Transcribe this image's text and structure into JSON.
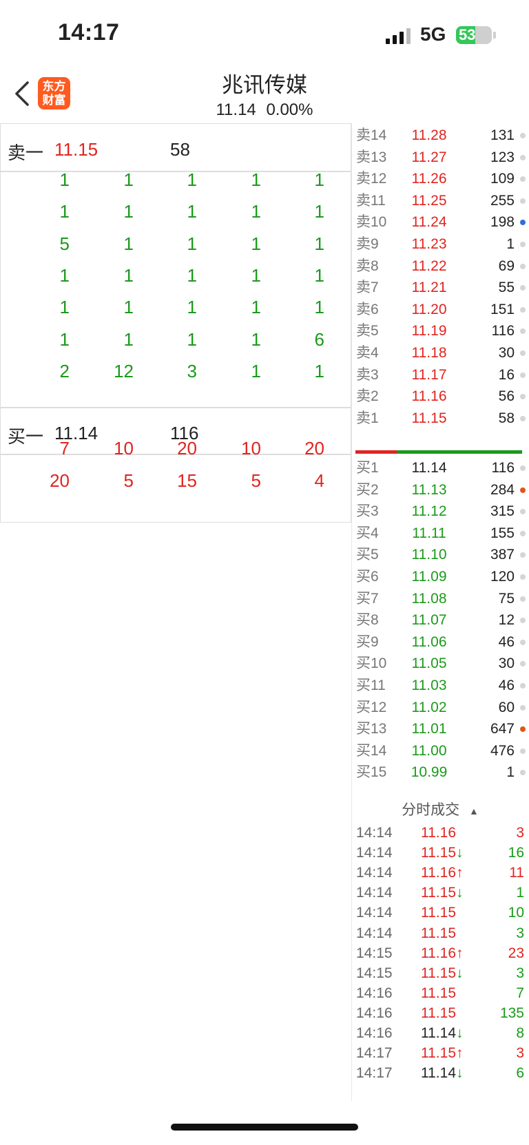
{
  "status_bar": {
    "time": "14:17",
    "network": "5G",
    "battery": "53"
  },
  "header": {
    "logo_line1": "东方",
    "logo_line2": "财富",
    "title": "兆讯传媒",
    "price": "11.14",
    "change": "0.00%"
  },
  "left_panel": {
    "ask": {
      "label": "卖一",
      "price": "11.15",
      "volume": "58"
    },
    "ask_queue": [
      [
        "1",
        "1",
        "1",
        "1",
        "1"
      ],
      [
        "1",
        "1",
        "1",
        "1",
        "1"
      ],
      [
        "5",
        "1",
        "1",
        "1",
        "1"
      ],
      [
        "1",
        "1",
        "1",
        "1",
        "1"
      ],
      [
        "1",
        "1",
        "1",
        "1",
        "1"
      ],
      [
        "1",
        "1",
        "1",
        "1",
        "6"
      ],
      [
        "2",
        "12",
        "3",
        "1",
        "1"
      ]
    ],
    "bid": {
      "label": "买一",
      "price": "11.14",
      "volume": "116"
    },
    "bid_queue": [
      [
        "7",
        "10",
        "20",
        "10",
        "20"
      ],
      [
        "20",
        "5",
        "15",
        "5",
        "4"
      ]
    ]
  },
  "order_book": {
    "asks": [
      {
        "label": "卖14",
        "price": "11.28",
        "volume": "131",
        "dot": "#d5d5d5"
      },
      {
        "label": "卖13",
        "price": "11.27",
        "volume": "123",
        "dot": "#d5d5d5"
      },
      {
        "label": "卖12",
        "price": "11.26",
        "volume": "109",
        "dot": "#d5d5d5"
      },
      {
        "label": "卖11",
        "price": "11.25",
        "volume": "255",
        "dot": "#d5d5d5"
      },
      {
        "label": "卖10",
        "price": "11.24",
        "volume": "198",
        "dot": "#2f6fd6"
      },
      {
        "label": "卖9",
        "price": "11.23",
        "volume": "1",
        "dot": "#d5d5d5"
      },
      {
        "label": "卖8",
        "price": "11.22",
        "volume": "69",
        "dot": "#d5d5d5"
      },
      {
        "label": "卖7",
        "price": "11.21",
        "volume": "55",
        "dot": "#d5d5d5"
      },
      {
        "label": "卖6",
        "price": "11.20",
        "volume": "151",
        "dot": "#d5d5d5"
      },
      {
        "label": "卖5",
        "price": "11.19",
        "volume": "116",
        "dot": "#d5d5d5"
      },
      {
        "label": "卖4",
        "price": "11.18",
        "volume": "30",
        "dot": "#d5d5d5"
      },
      {
        "label": "卖3",
        "price": "11.17",
        "volume": "16",
        "dot": "#d5d5d5"
      },
      {
        "label": "卖2",
        "price": "11.16",
        "volume": "56",
        "dot": "#d5d5d5"
      },
      {
        "label": "卖1",
        "price": "11.15",
        "volume": "58",
        "dot": "#d5d5d5"
      }
    ],
    "bids": [
      {
        "label": "买1",
        "price": "11.14",
        "volume": "116",
        "dot": "#d5d5d5",
        "color": "black"
      },
      {
        "label": "买2",
        "price": "11.13",
        "volume": "284",
        "dot": "#e0561a",
        "color": "green"
      },
      {
        "label": "买3",
        "price": "11.12",
        "volume": "315",
        "dot": "#d5d5d5",
        "color": "green"
      },
      {
        "label": "买4",
        "price": "11.11",
        "volume": "155",
        "dot": "#d5d5d5",
        "color": "green"
      },
      {
        "label": "买5",
        "price": "11.10",
        "volume": "387",
        "dot": "#d5d5d5",
        "color": "green"
      },
      {
        "label": "买6",
        "price": "11.09",
        "volume": "120",
        "dot": "#d5d5d5",
        "color": "green"
      },
      {
        "label": "买7",
        "price": "11.08",
        "volume": "75",
        "dot": "#d5d5d5",
        "color": "green"
      },
      {
        "label": "买8",
        "price": "11.07",
        "volume": "12",
        "dot": "#d5d5d5",
        "color": "green"
      },
      {
        "label": "买9",
        "price": "11.06",
        "volume": "46",
        "dot": "#d5d5d5",
        "color": "green"
      },
      {
        "label": "买10",
        "price": "11.05",
        "volume": "30",
        "dot": "#d5d5d5",
        "color": "green"
      },
      {
        "label": "买11",
        "price": "11.03",
        "volume": "46",
        "dot": "#d5d5d5",
        "color": "green"
      },
      {
        "label": "买12",
        "price": "11.02",
        "volume": "60",
        "dot": "#d5d5d5",
        "color": "green"
      },
      {
        "label": "买13",
        "price": "11.01",
        "volume": "647",
        "dot": "#e0561a",
        "color": "green"
      },
      {
        "label": "买14",
        "price": "11.00",
        "volume": "476",
        "dot": "#d5d5d5",
        "color": "green"
      },
      {
        "label": "买15",
        "price": "10.99",
        "volume": "1",
        "dot": "#d5d5d5",
        "color": "green"
      }
    ]
  },
  "ticks": {
    "title": "分时成交",
    "rows": [
      {
        "time": "14:14",
        "price": "11.16",
        "arrow": "",
        "price_color": "red",
        "volume": "3",
        "vol_color": "red"
      },
      {
        "time": "14:14",
        "price": "11.15",
        "arrow": "↓",
        "price_color": "red",
        "volume": "16",
        "vol_color": "green"
      },
      {
        "time": "14:14",
        "price": "11.16",
        "arrow": "↑",
        "price_color": "red",
        "volume": "11",
        "vol_color": "red"
      },
      {
        "time": "14:14",
        "price": "11.15",
        "arrow": "↓",
        "price_color": "red",
        "volume": "1",
        "vol_color": "green"
      },
      {
        "time": "14:14",
        "price": "11.15",
        "arrow": "",
        "price_color": "red",
        "volume": "10",
        "vol_color": "green"
      },
      {
        "time": "14:14",
        "price": "11.15",
        "arrow": "",
        "price_color": "red",
        "volume": "3",
        "vol_color": "green"
      },
      {
        "time": "14:15",
        "price": "11.16",
        "arrow": "↑",
        "price_color": "red",
        "volume": "23",
        "vol_color": "red"
      },
      {
        "time": "14:15",
        "price": "11.15",
        "arrow": "↓",
        "price_color": "red",
        "volume": "3",
        "vol_color": "green"
      },
      {
        "time": "14:16",
        "price": "11.15",
        "arrow": "",
        "price_color": "red",
        "volume": "7",
        "vol_color": "green"
      },
      {
        "time": "14:16",
        "price": "11.15",
        "arrow": "",
        "price_color": "red",
        "volume": "135",
        "vol_color": "green"
      },
      {
        "time": "14:16",
        "price": "11.14",
        "arrow": "↓",
        "price_color": "black",
        "volume": "8",
        "vol_color": "green"
      },
      {
        "time": "14:17",
        "price": "11.15",
        "arrow": "↑",
        "price_color": "red",
        "volume": "3",
        "vol_color": "red"
      },
      {
        "time": "14:17",
        "price": "11.14",
        "arrow": "↓",
        "price_color": "black",
        "volume": "6",
        "vol_color": "green"
      }
    ]
  }
}
